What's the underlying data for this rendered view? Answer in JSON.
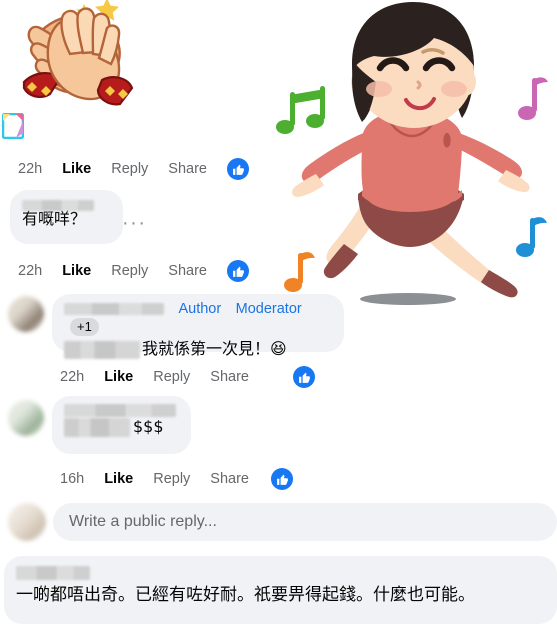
{
  "app": {
    "name": "facebook-comments-thread",
    "accent_color": "#1877f2",
    "link_color": "#1b74e4",
    "bubble_color": "#f0f2f5",
    "text_color": "#050505",
    "muted_text_color": "#65676b"
  },
  "sticker": {
    "name": "clapping-hands-sticker",
    "badge_name": "sticker-source-badge"
  },
  "illustration": {
    "name": "dancing-girl-illustration",
    "alt": "Illustration of a girl dancing with music notes",
    "hair_color": "#2b211f",
    "skin_color": "#fbdcc0",
    "top_color": "#e1786f",
    "skirt_color": "#8e4a46",
    "shoe_color": "#8e4a46",
    "shadow_color": "#8c9094",
    "notes": [
      {
        "name": "music-note-green",
        "color": "#4caf30"
      },
      {
        "name": "music-note-purple",
        "color": "#c967b5"
      },
      {
        "name": "music-note-orange",
        "color": "#ef8326"
      },
      {
        "name": "music-note-blue",
        "color": "#1f8fd6"
      }
    ]
  },
  "comments": [
    {
      "id": "comment-1",
      "content_type": "sticker",
      "actions": {
        "timestamp": "22h",
        "like": "Like",
        "reply": "Reply",
        "share": "Share",
        "reaction_icon": "thumbs-up-icon"
      }
    },
    {
      "id": "comment-2",
      "content_type": "text",
      "author_name_redacted": true,
      "text": "有嘅咩？",
      "more_menu": "···",
      "actions": {
        "timestamp": "22h",
        "like": "Like",
        "reply": "Reply",
        "share": "Share",
        "reaction_icon": "thumbs-up-icon"
      }
    },
    {
      "id": "comment-3",
      "content_type": "text",
      "author_name_redacted": true,
      "roles": [
        "Author",
        "Moderator"
      ],
      "extra_badge": "+1",
      "text": "我就係第一次見！",
      "emoji": "😆",
      "actions": {
        "timestamp": "22h",
        "like": "Like",
        "reply": "Reply",
        "share": "Share",
        "reaction_icon": "thumbs-up-icon"
      }
    },
    {
      "id": "comment-4",
      "content_type": "text",
      "author_name_redacted": true,
      "text": "$$$",
      "actions": {
        "timestamp": "16h",
        "like": "Like",
        "reply": "Reply",
        "share": "Share",
        "reaction_icon": "thumbs-up-icon"
      }
    }
  ],
  "composer": {
    "name": "reply-composer",
    "placeholder": "Write a public reply..."
  },
  "bottom_comment": {
    "id": "comment-5",
    "author_name_redacted": true,
    "text": "一啲都唔出奇。已經有咗好耐。祇要畀得起錢。什麼也可能。"
  }
}
